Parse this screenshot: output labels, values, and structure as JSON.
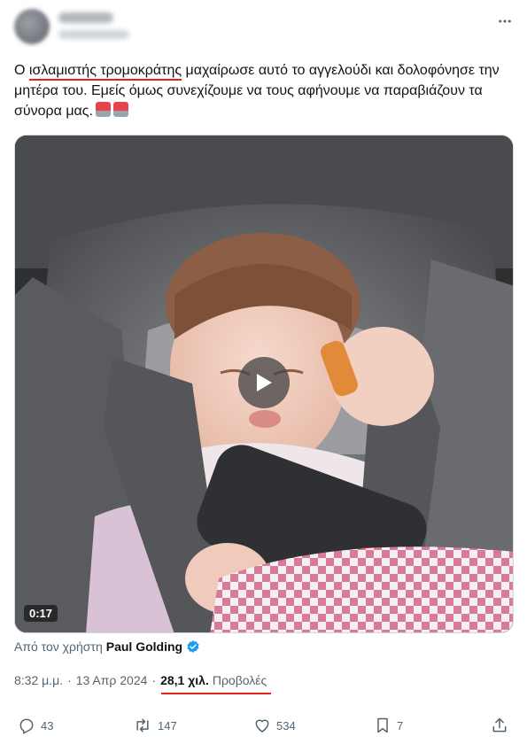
{
  "tweet": {
    "text_highlight": "ισλαμιστής τρομοκράτης",
    "text_rest": " μαχαίρωσε αυτό το αγγελούδι και δολοφόνησε την μητέρα του. Εμείς όμως συνεχίζουμε να τους αφήνουμε να παραβιάζουν τα σύνορα μας.",
    "text_prefix": "Ο "
  },
  "media": {
    "duration": "0:17"
  },
  "attribution": {
    "prefix": "Από τον χρήστη",
    "username": "Paul Golding"
  },
  "meta": {
    "time": "8:32 μ.μ.",
    "separator": "·",
    "date": "13 Απρ 2024",
    "views_count": "28,1 χιλ.",
    "views_label": "Προβολές"
  },
  "actions": {
    "replies": "43",
    "retweets": "147",
    "likes": "534",
    "bookmarks": "7"
  },
  "colors": {
    "accent": "#1d9bf0",
    "highlight_underline": "#e0241b",
    "secondary_text": "#536471"
  }
}
